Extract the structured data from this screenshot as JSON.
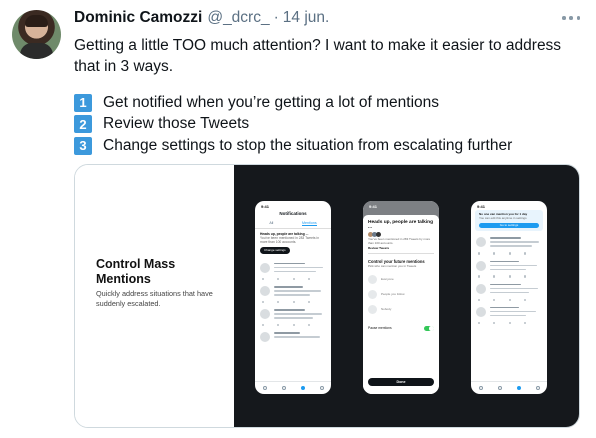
{
  "tweet": {
    "author_name": "Dominic Camozzi",
    "handle": "@_dcrc_",
    "separator": "·",
    "date": "14 jun.",
    "text": "Getting a little TOO much attention? I want to make it easier to address that in 3 ways.",
    "items": [
      {
        "num": "1",
        "text": "Get notified when you’re getting a lot of mentions"
      },
      {
        "num": "2",
        "text": "Review those Tweets"
      },
      {
        "num": "3",
        "text": "Change settings to stop the situation from escalating further"
      }
    ],
    "more_icon": "more-horizontal-icon"
  },
  "card": {
    "title": "Control Mass Mentions",
    "subtitle": "Quickly address situations that have suddenly escalated.",
    "colors": {
      "left_bg": "#ffffff",
      "right_bg": "#15181c",
      "accent": "#1d9bf0"
    },
    "phone1": {
      "status_time": "9:41",
      "header": "Notifications",
      "tabs": [
        "All",
        "Mentions"
      ],
      "alert_title": "Heads up, people are talking ...",
      "alert_text": "You’ve been mentioned in 283 Tweets in more than 100 accounts.",
      "alert_button": "Change settings"
    },
    "phone2": {
      "status_time": "9:41",
      "header": "Notifications",
      "sheet_title": "Heads up, people are talking ...",
      "sheet_text": "You’ve been mentioned in 283 Tweets by more than 100 accounts.",
      "review_label": "Review Tweets",
      "section_title": "Control your future mentions",
      "section_text": "Pick who can mention you in Tweets",
      "options": [
        "Everyone",
        "People you follow",
        "Nobody"
      ],
      "pause_label": "Pause mentions",
      "done_label": "Done"
    },
    "phone3": {
      "status_time": "9:41",
      "banner_text": "No one can mention you for 1 day",
      "banner_sub": "You can edit this anytime in settings",
      "banner_button": "Go to settings"
    }
  }
}
